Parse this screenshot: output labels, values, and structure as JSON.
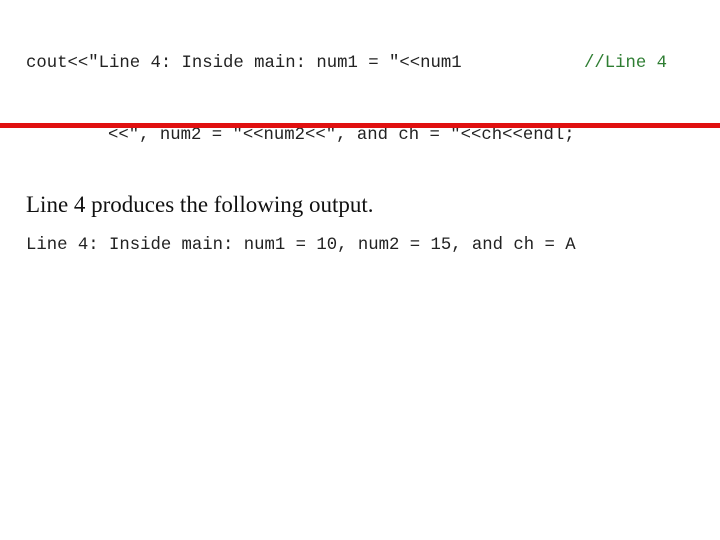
{
  "code": {
    "line1": "cout<<\"Line 4: Inside main: num1 = \"<<num1",
    "line2": "<<\", num2 = \"<<num2<<\", and ch = \"<<ch<<endl;",
    "comment": "//Line 4",
    "comment_color": "#2e7d32"
  },
  "divider_color": "#e01010",
  "caption": "Line 4 produces the following output.",
  "output": "Line 4: Inside main: num1 = 10, num2 = 15, and ch = A"
}
